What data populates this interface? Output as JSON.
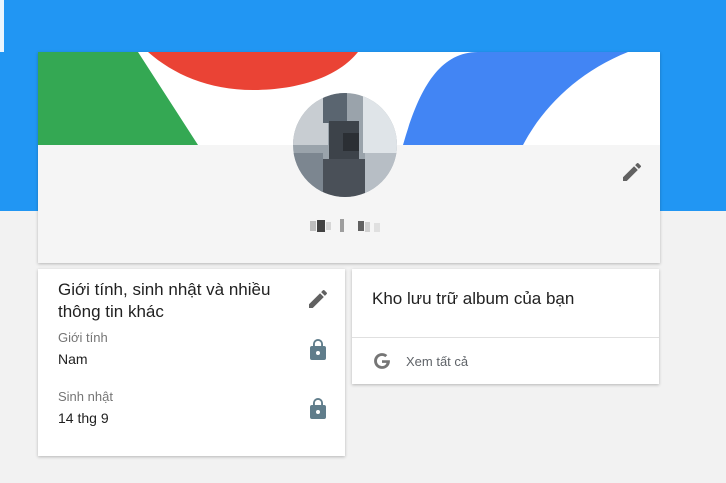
{
  "colors": {
    "header": "#2196f3",
    "cover_red": "#ea4335",
    "cover_green": "#34a853",
    "cover_blue": "#4285f4",
    "icon_gray": "#616161",
    "lock_gray": "#607d8b"
  },
  "profile": {
    "name": "",
    "edit_icon": "pencil-icon"
  },
  "about": {
    "title": "Giới tính, sinh nhật và nhiều thông tin khác",
    "fields": [
      {
        "label": "Giới tính",
        "value": "Nam",
        "icon": "lock-icon"
      },
      {
        "label": "Sinh nhật",
        "value": "14 thg 9",
        "icon": "lock-icon"
      }
    ]
  },
  "album": {
    "title": "Kho lưu trữ album của bạn",
    "link_label": "Xem tất cả",
    "link_icon": "google-g-icon"
  }
}
